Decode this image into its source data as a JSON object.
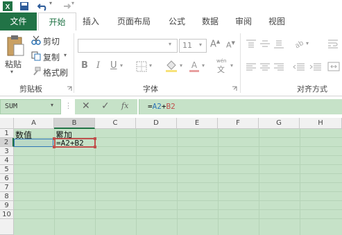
{
  "qat": {
    "app_icon": "excel-logo-icon",
    "undo_icon": "undo-icon",
    "redo_icon": "redo-icon",
    "more_icon": "customize-qat-icon"
  },
  "tabs": [
    "文件",
    "开始",
    "插入",
    "页面布局",
    "公式",
    "数据",
    "审阅",
    "视图"
  ],
  "ribbon": {
    "clipboard": {
      "paste": "粘贴",
      "cut": "剪切",
      "copy": "复制",
      "format_painter": "格式刷",
      "group_label": "剪贴板"
    },
    "font": {
      "font_size": "11",
      "bold": "B",
      "italic": "I",
      "underline": "U",
      "group_label": "字体",
      "wen": "文"
    },
    "alignment": {
      "group_label": "对齐方式"
    }
  },
  "formula_bar": {
    "name_box": "SUM",
    "formula_prefix": "=",
    "ref1": "A2",
    "plus": "+",
    "ref2": "B2",
    "fx": "fx"
  },
  "grid": {
    "columns": [
      "A",
      "B",
      "C",
      "D",
      "E",
      "F",
      "G",
      "H"
    ],
    "rows": [
      "1",
      "2",
      "3",
      "4",
      "5",
      "6",
      "7",
      "8",
      "9",
      "10"
    ],
    "cells": {
      "A1": "数值",
      "B1": "累加",
      "B2": "=A2+B2"
    }
  },
  "colors": {
    "accent": "#217346",
    "ref_a2": "#2e75b6",
    "ref_b2": "#c0504d",
    "grid_bg": "#c6e2c8"
  }
}
